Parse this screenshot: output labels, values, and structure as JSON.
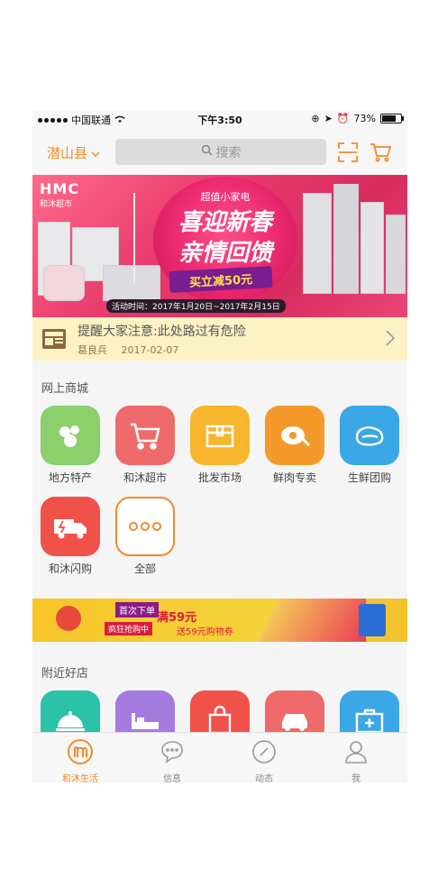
{
  "status_bar": {
    "carrier": "中国联通",
    "time": "下午3:50",
    "battery": "73%"
  },
  "header": {
    "city": "潜山县",
    "search_placeholder": "搜索"
  },
  "banner": {
    "logo": "HMC",
    "logo_sub": "和沐超市",
    "subtitle": "超值小家电",
    "title_line1": "喜迎新春",
    "title_line2": "亲情回馈",
    "promo": "买立减50元",
    "date_range": "活动时间：2017年1月20日~2017年2月15日"
  },
  "notice": {
    "text": "提醒大家注意:此处路过有危险",
    "author": "葛良兵",
    "date": "2017-02-07"
  },
  "mall": {
    "title": "网上商城",
    "items": [
      {
        "label": "地方特产",
        "icon": "local-specialty-icon",
        "color": "#8ccf6b"
      },
      {
        "label": "和沐超市",
        "icon": "shopping-cart-icon",
        "color": "#ef6a6a"
      },
      {
        "label": "批发市场",
        "icon": "box-icon",
        "color": "#f7b62e"
      },
      {
        "label": "鲜肉专卖",
        "icon": "meat-icon",
        "color": "#f39a2a"
      },
      {
        "label": "生鲜团购",
        "icon": "fresh-meat-icon",
        "color": "#3aa7e6"
      },
      {
        "label": "和沐闪购",
        "icon": "delivery-truck-icon",
        "color": "#f0524a"
      },
      {
        "label": "全部",
        "icon": "more-icon",
        "color": "#f08a2c"
      }
    ]
  },
  "ad": {
    "tag1": "首次下单",
    "headline": "满59元",
    "tag2": "疯狂抢购中",
    "sub": "送59元购物券"
  },
  "nearby": {
    "title": "附近好店",
    "items": [
      {
        "icon": "food-cloche-icon",
        "color": "#2bc3a8"
      },
      {
        "icon": "hotel-bed-icon",
        "color": "#a67be0"
      },
      {
        "icon": "shopping-bag-icon",
        "color": "#f0524a"
      },
      {
        "icon": "car-icon",
        "color": "#ef6a6a"
      },
      {
        "icon": "medical-kit-icon",
        "color": "#3aa7e6"
      }
    ]
  },
  "tabs": [
    {
      "label": "和沐生活",
      "icon": "home-logo-icon",
      "active": true
    },
    {
      "label": "信息",
      "icon": "chat-icon",
      "active": false
    },
    {
      "label": "动态",
      "icon": "compass-icon",
      "active": false
    },
    {
      "label": "我",
      "icon": "user-icon",
      "active": false
    }
  ]
}
